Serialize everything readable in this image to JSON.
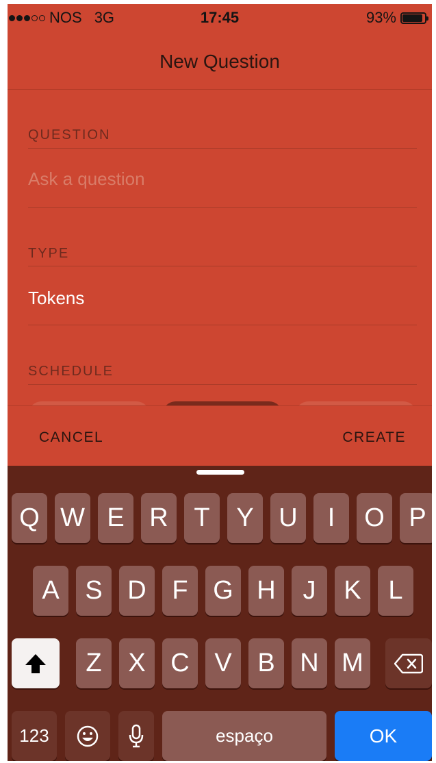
{
  "status_bar": {
    "carrier": "NOS",
    "network": "3G",
    "time": "17:45",
    "battery": "93%",
    "signal_bars": 3
  },
  "nav": {
    "title": "New Question"
  },
  "form": {
    "question_label": "QUESTION",
    "question_placeholder": "Ask a question",
    "type_label": "TYPE",
    "type_value": "Tokens",
    "schedule_label": "SCHEDULE"
  },
  "actions": {
    "cancel_label": "CANCEL",
    "create_label": "CREATE"
  },
  "keyboard": {
    "row1": [
      "Q",
      "W",
      "E",
      "R",
      "T",
      "Y",
      "U",
      "I",
      "O",
      "P"
    ],
    "row2": [
      "A",
      "S",
      "D",
      "F",
      "G",
      "H",
      "J",
      "K",
      "L"
    ],
    "row3": [
      "Z",
      "X",
      "C",
      "V",
      "B",
      "N",
      "M"
    ],
    "numbers_label": "123",
    "space_label": "espaço",
    "ok_label": "OK",
    "shift_icon": "shift-arrow",
    "delete_icon": "backspace",
    "emoji_icon": "smiley",
    "mic_icon": "microphone"
  },
  "colors": {
    "app_background": "#cd4631",
    "keyboard_background": "#5f2418",
    "ok_key": "#1a7cf6"
  }
}
